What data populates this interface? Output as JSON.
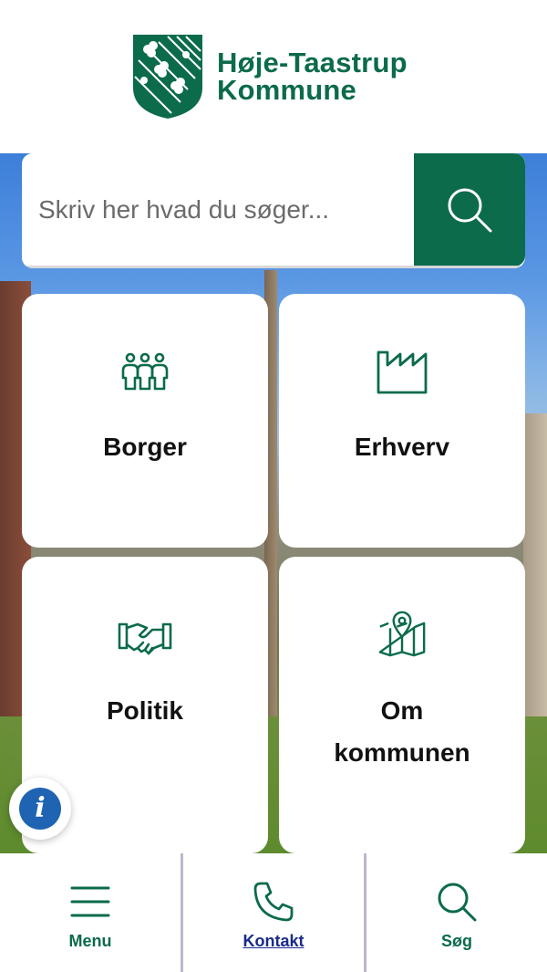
{
  "header": {
    "logo_line1": "Høje-Taastrup",
    "logo_line2": "Kommune",
    "logo_icon": "shield-crest-icon"
  },
  "search": {
    "placeholder": "Skriv her hvad du søger...",
    "icon": "search-icon"
  },
  "tiles": [
    {
      "label": "Borger",
      "icon": "people-icon"
    },
    {
      "label": "Erhverv",
      "icon": "factory-icon"
    },
    {
      "label": "Politik",
      "icon": "handshake-icon"
    },
    {
      "label_line1": "Om",
      "label_line2": "kommunen",
      "icon": "map-pin-icon"
    }
  ],
  "info_button": {
    "glyph": "i",
    "icon": "info-icon"
  },
  "bottom_nav": [
    {
      "label": "Menu",
      "icon": "hamburger-menu-icon"
    },
    {
      "label": "Kontakt",
      "icon": "phone-icon"
    },
    {
      "label": "Søg",
      "icon": "search-icon"
    }
  ],
  "colors": {
    "brand_green": "#0b6b4a",
    "info_blue": "#1f63b3",
    "link_blue": "#1a2a8a"
  }
}
